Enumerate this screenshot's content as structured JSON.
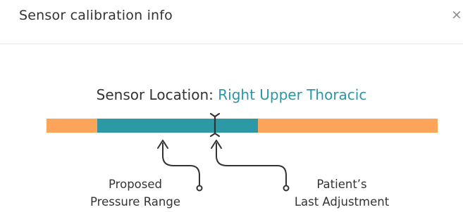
{
  "dialog": {
    "title": "Sensor calibration info",
    "close_glyph": "×"
  },
  "sensor": {
    "location_label": "Sensor Location:",
    "location_value": "Right Upper Thoracic"
  },
  "scale": {
    "proposed_range": {
      "start": 0.13,
      "end": 0.54
    },
    "last_adjustment": 0.43,
    "colors": {
      "track": "#fba45a",
      "range": "#2c99a5",
      "accent_text": "#2a96a6"
    }
  },
  "annotations": {
    "proposed_line1": "Proposed",
    "proposed_line2": "Pressure Range",
    "patient_line1": "Patient’s",
    "patient_line2": "Last Adjustment"
  }
}
